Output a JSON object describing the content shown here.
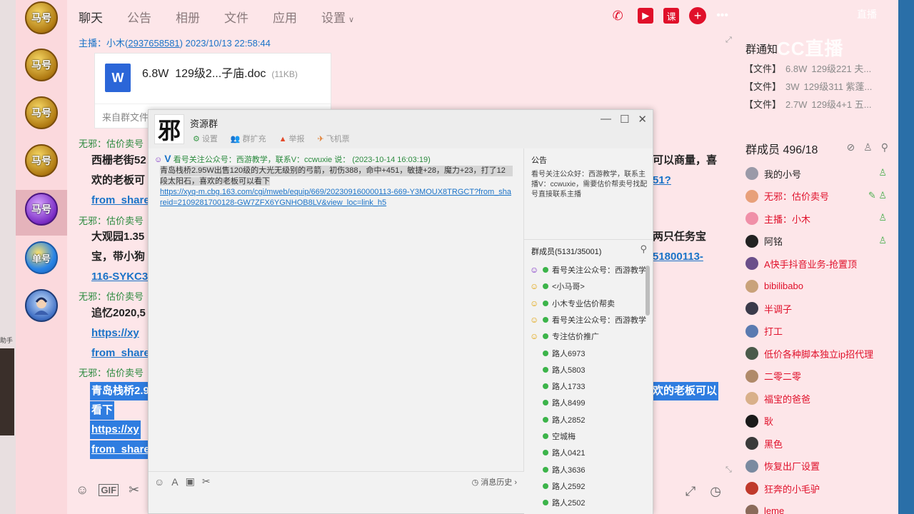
{
  "tabs": [
    {
      "label": "聊天"
    },
    {
      "label": "公告"
    },
    {
      "label": "相册"
    },
    {
      "label": "文件"
    },
    {
      "label": "应用"
    },
    {
      "label": "设置"
    }
  ],
  "top_right_label": "直播",
  "watermark": "CC直播",
  "left_strip_text": "助手",
  "groups": [
    {
      "label": "马号"
    },
    {
      "label": "马号"
    },
    {
      "label": "马号"
    },
    {
      "label": "马号"
    },
    {
      "label": "马号"
    },
    {
      "label": "单号"
    },
    {
      "label": ""
    }
  ],
  "chat": {
    "msg1_sender_role": "主播：",
    "msg1_sender_name": "小木(",
    "msg1_sender_id": "2937658581",
    "msg1_sender_tail": ") 2023/10/13 22:58:44",
    "file_icon": "W",
    "file_size_display": "6.8W",
    "file_name": "129级2...子庙.doc",
    "file_size": "(11KB)",
    "file_from": "来自群文件",
    "msg2_sender": "无邪：估价卖号",
    "msg2_line1": "西栅老街52",
    "msg2_line1_right": "可以商量，喜",
    "msg2_line2": "欢的老板可",
    "msg2_line2_right": "51?",
    "msg2_link": "from_share",
    "msg3_sender": "无邪：估价卖号",
    "msg3_line1": "大观园1.35",
    "msg3_line1_right": "两只任务宝",
    "msg3_line2": "宝，带小狗",
    "msg3_line2_right": "51800113-",
    "msg3_link": "116-SYKC3",
    "msg4_sender": "无邪：估价卖号",
    "msg4_line1": "追忆2020,5",
    "msg4_link1": "https://xy",
    "msg4_link2": "from_share",
    "msg5_sender": "无邪：估价卖号",
    "msg5_line1": "青岛栈桥2.9",
    "msg5_line1_right": "欢的老板可以",
    "msg5_line2": "看下",
    "msg5_line3": "https://xy",
    "msg5_line4": "from_share"
  },
  "popup": {
    "title": "资源群",
    "logo": "邪",
    "tools": [
      {
        "label": "设置"
      },
      {
        "label": "群扩充"
      },
      {
        "label": "举报"
      },
      {
        "label": "飞机票"
      }
    ],
    "msg_badge": "V",
    "msg_head": "看号关注公众号：西游教学，联系V：ccwuxie  说：  (2023-10-14 16:03:19)",
    "msg_body_line1": "青岛栈桥2.95W出售120级的大光无级别的弓箭，初伤388，命中+451，敏捷+28，魔力+23，打了12",
    "msg_body_line2": "段太阳石，喜欢的老板可以看下",
    "msg_url": "https://xyq-m.cbg.163.com/cgi/mweb/equip/669/202309160000113-669-Y3MOUX8TRGCT?from_shareid=2109281700128-GW7ZFX6YGNHOB8LV&view_loc=link_h5",
    "history": "消息历史 ›",
    "notice_title": "公告",
    "notice_body": "看号关注公众好：西游教学，联系主播V：ccwuxie，需要估价帮卖号找配号直接联系主播",
    "members_title": "群成员(5131/35001)",
    "members": [
      {
        "name": "看号关注公众号：西游教学",
        "face": "☺",
        "kind": "purple"
      },
      {
        "name": "<小马哥>",
        "face": "☺",
        "kind": "yellow"
      },
      {
        "name": "小木专业估价帮卖",
        "face": "☺",
        "kind": "yellow"
      },
      {
        "name": "看号关注公众号：西游教学",
        "face": "☺",
        "kind": "yellow"
      },
      {
        "name": "专注估价推广",
        "face": "☺",
        "kind": "yellow"
      },
      {
        "name": "路人6973",
        "face": "",
        "kind": "none"
      },
      {
        "name": "路人5803",
        "face": "",
        "kind": "none"
      },
      {
        "name": "路人1733",
        "face": "",
        "kind": "none"
      },
      {
        "name": "路人8499",
        "face": "",
        "kind": "none"
      },
      {
        "name": "路人2852",
        "face": "",
        "kind": "none"
      },
      {
        "name": "空城梅",
        "face": "",
        "kind": "none"
      },
      {
        "name": "路人0421",
        "face": "",
        "kind": "none"
      },
      {
        "name": "路人3636",
        "face": "",
        "kind": "none"
      },
      {
        "name": "路人2592",
        "face": "",
        "kind": "none"
      },
      {
        "name": "路人2502",
        "face": "",
        "kind": "none"
      }
    ]
  },
  "right": {
    "notice_title": "群通知",
    "files": [
      {
        "tag": "【文件】",
        "size": "6.8W",
        "desc": "129级221  夫..."
      },
      {
        "tag": "【文件】",
        "size": "3W",
        "desc": "129级311  紫蓬..."
      },
      {
        "tag": "【文件】",
        "size": "2.7W",
        "desc": "129级4+1  五..."
      }
    ],
    "members_title": "群成员 496/18",
    "members": [
      {
        "name": "我的小号",
        "color": "dark",
        "avatar": "#9a9aa8"
      },
      {
        "name": "无邪：估价卖号",
        "color": "red",
        "avatar": "#e8a07a"
      },
      {
        "name": "主播：小木",
        "color": "red",
        "avatar": "#f08fa8"
      },
      {
        "name": "阿铭",
        "color": "dark",
        "avatar": "#222222"
      },
      {
        "name": "A快手抖音业务-抢置顶",
        "color": "red",
        "avatar": "#6a4f8a"
      },
      {
        "name": "bibilibabo",
        "color": "red",
        "avatar": "#c9a27a"
      },
      {
        "name": "半调子",
        "color": "red",
        "avatar": "#3a3a4a"
      },
      {
        "name": "打工",
        "color": "red",
        "avatar": "#5a7ab0"
      },
      {
        "name": "低价各种脚本独立ip招代理",
        "color": "red",
        "avatar": "#4a5a4a"
      },
      {
        "name": "二零二零",
        "color": "red",
        "avatar": "#b08a6a"
      },
      {
        "name": "福宝的爸爸",
        "color": "red",
        "avatar": "#d9b08a"
      },
      {
        "name": "耿",
        "color": "red",
        "avatar": "#1a1a1a"
      },
      {
        "name": "黑色",
        "color": "red",
        "avatar": "#3a3a3a"
      },
      {
        "name": "恢复出厂设置",
        "color": "red",
        "avatar": "#7a8aa0"
      },
      {
        "name": "狂奔的小毛驴",
        "color": "red",
        "avatar": "#c0392b"
      },
      {
        "name": "leme",
        "color": "red",
        "avatar": "#8a6a5a"
      }
    ]
  }
}
